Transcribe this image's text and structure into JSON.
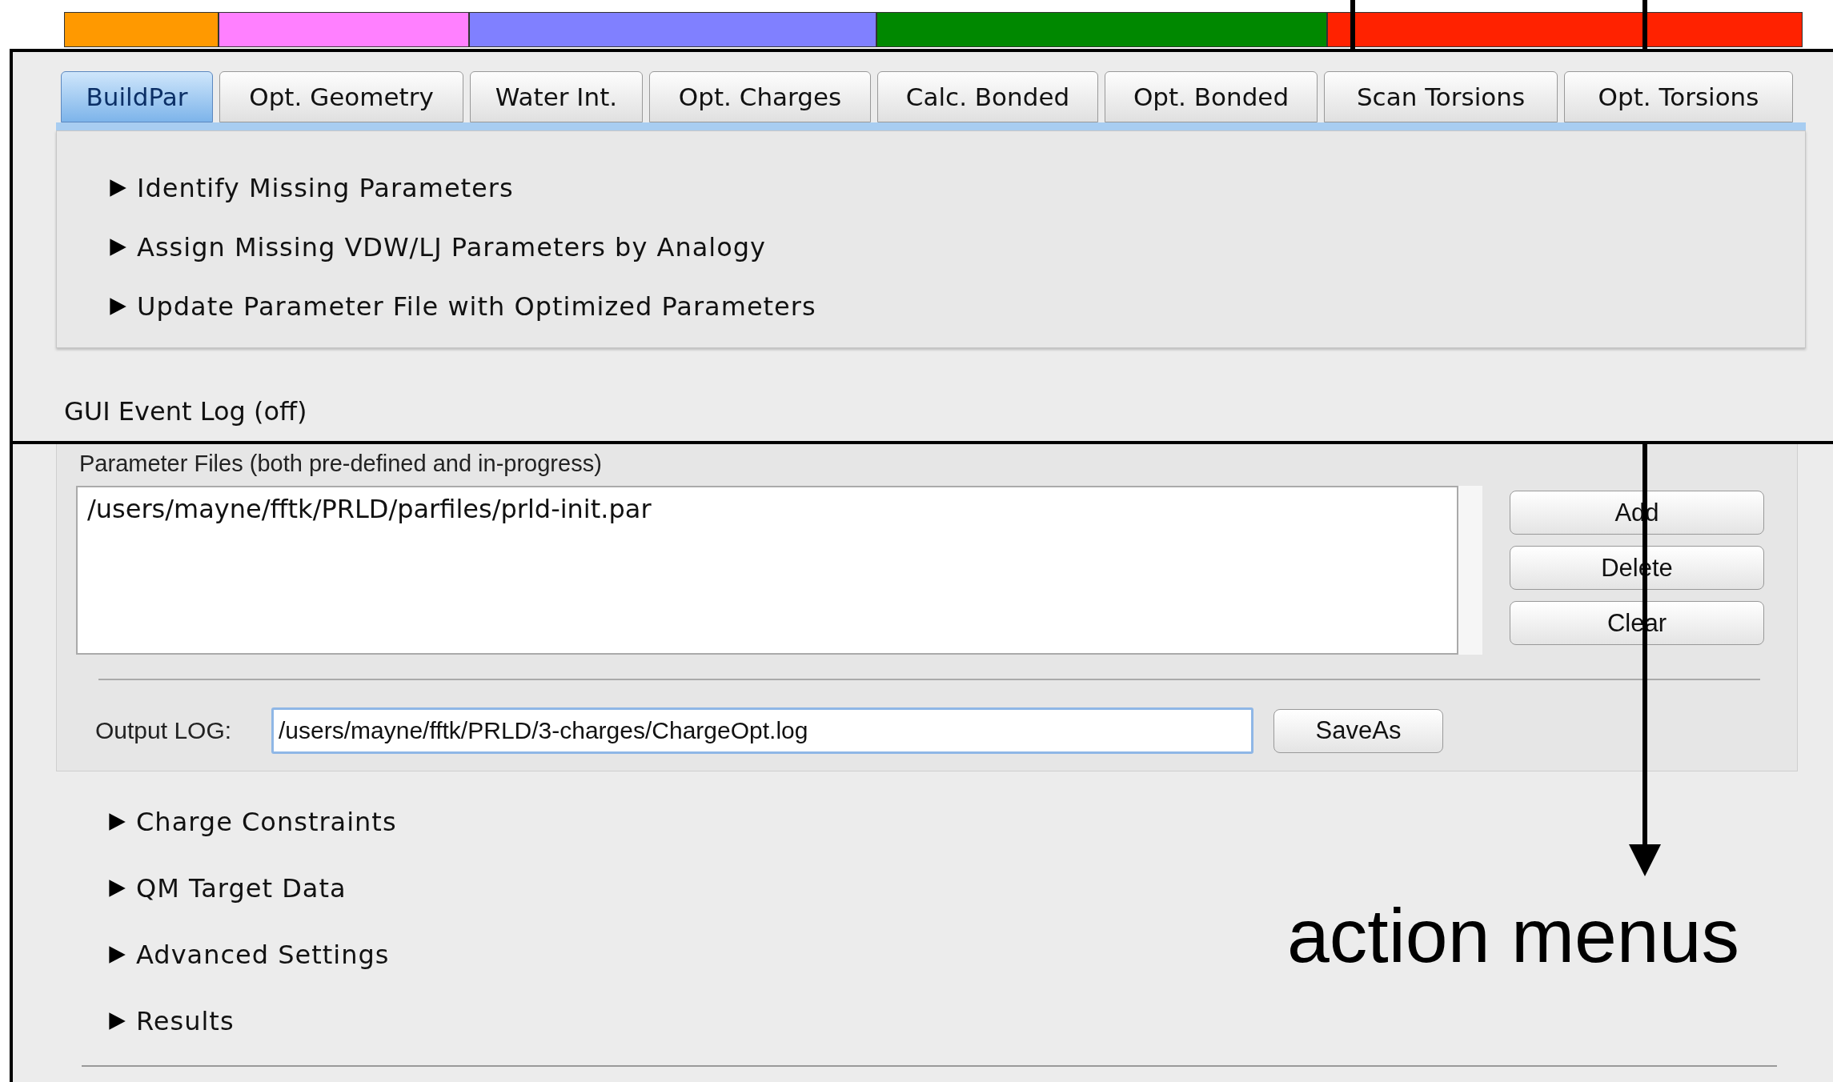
{
  "color_bar": [
    {
      "color": "#ff9900"
    },
    {
      "color": "#ff80ff"
    },
    {
      "color": "#8080ff"
    },
    {
      "color": "#008800"
    },
    {
      "color": "#ff2200"
    }
  ],
  "tabs": [
    {
      "label": "BuildPar",
      "selected": true
    },
    {
      "label": "Opt. Geometry",
      "selected": false
    },
    {
      "label": "Water Int.",
      "selected": false
    },
    {
      "label": "Opt. Charges",
      "selected": false
    },
    {
      "label": "Calc. Bonded",
      "selected": false
    },
    {
      "label": "Opt. Bonded",
      "selected": false
    },
    {
      "label": "Scan Torsions",
      "selected": false
    },
    {
      "label": "Opt. Torsions",
      "selected": false
    }
  ],
  "sections": [
    {
      "label": "Identify Missing Parameters",
      "expanded": false
    },
    {
      "label": "Assign Missing VDW/LJ Parameters by Analogy",
      "expanded": false
    },
    {
      "label": "Update Parameter File with Optimized Parameters",
      "expanded": false
    }
  ],
  "event_log": {
    "label": "GUI Event Log (off)"
  },
  "parameter_files": {
    "label": "Parameter Files (both pre-defined and in-progress)",
    "files": [
      "/users/mayne/fftk/PRLD/parfiles/prld-init.par"
    ],
    "buttons": [
      "Add",
      "Delete",
      "Clear"
    ]
  },
  "output_log": {
    "label": "Output LOG:",
    "value": "/users/mayne/fftk/PRLD/3-charges/ChargeOpt.log",
    "button": "SaveAs"
  },
  "option_sections": [
    {
      "label": "Charge Constraints",
      "expanded": false
    },
    {
      "label": "QM Target Data",
      "expanded": false
    },
    {
      "label": "Advanced Settings",
      "expanded": false
    },
    {
      "label": "Results",
      "expanded": false
    }
  ],
  "annotation": {
    "label": "action menus"
  }
}
